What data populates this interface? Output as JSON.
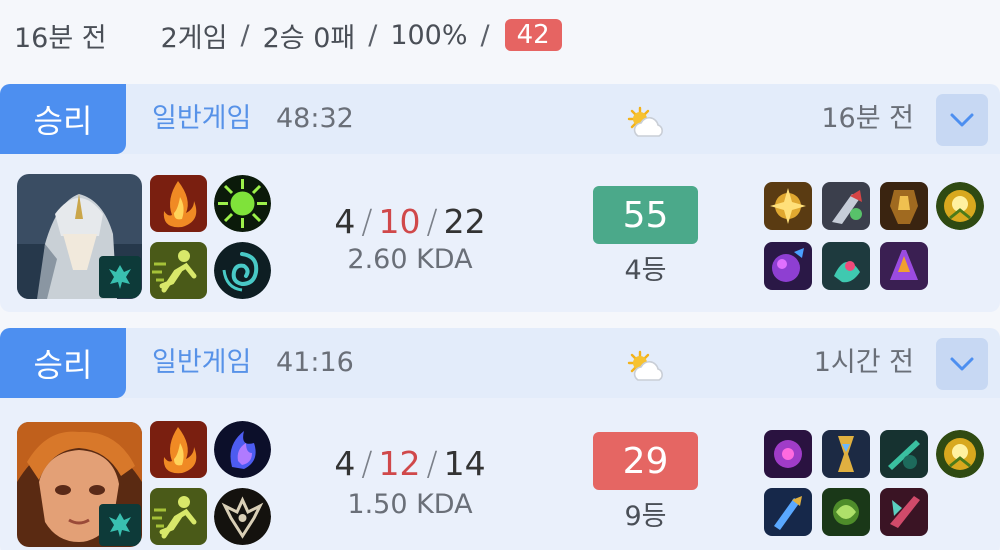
{
  "summary": {
    "time_ago": "16분 전",
    "games": "2게임",
    "record": "2승 0패",
    "winrate": "100%",
    "separator": "/",
    "score": "42"
  },
  "matches": [
    {
      "result": "승리",
      "mode": "일반게임",
      "duration": "48:32",
      "time_ago": "16분 전",
      "weather_icon": "partly-cloudy-icon",
      "kills": "4",
      "deaths": "10",
      "assists": "22",
      "slash": "/",
      "kda_ratio": "2.60 KDA",
      "performance_score": "55",
      "rank": "4등",
      "colors": {
        "score_bg": "#4ba98a"
      }
    },
    {
      "result": "승리",
      "mode": "일반게임",
      "duration": "41:16",
      "time_ago": "1시간 전",
      "weather_icon": "partly-cloudy-icon",
      "kills": "4",
      "deaths": "12",
      "assists": "14",
      "slash": "/",
      "kda_ratio": "1.50 KDA",
      "performance_score": "29",
      "rank": "9등",
      "colors": {
        "score_bg": "#e56663"
      }
    }
  ],
  "colors": {
    "win_badge": "#4d8ff0",
    "header_bg": "#e3ecfa",
    "body_bg": "#eaf0fb",
    "deaths": "#d0484a",
    "summary_score": "#e66462"
  }
}
